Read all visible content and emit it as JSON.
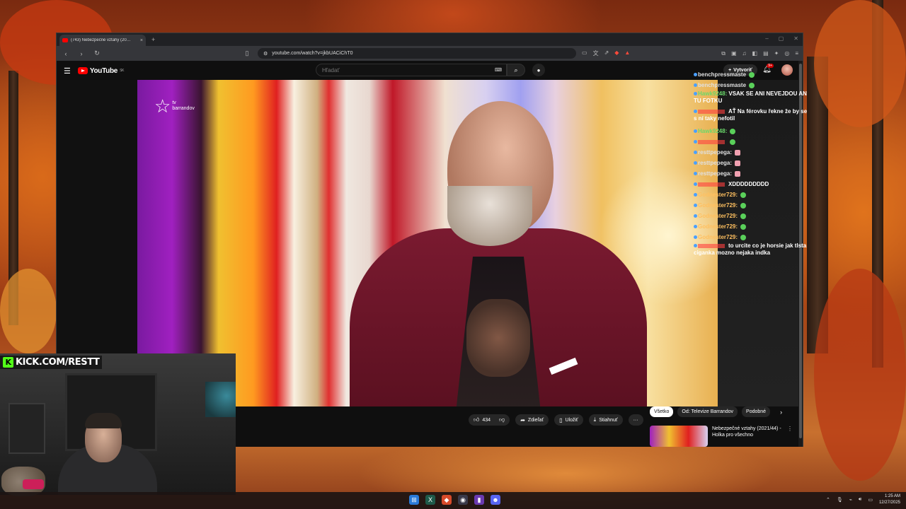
{
  "browser": {
    "tab_title": "(743) Nebezpečné vztahy (20…",
    "tab_close": "×",
    "new_tab": "+",
    "url": "youtube.com/watch?v=jkbUACiChT0",
    "minimize": "–",
    "maximize": "▢",
    "close": "✕"
  },
  "youtube": {
    "logo_text": "YouTube",
    "region": "SK",
    "search_placeholder": "Hľadať",
    "create_label": "Vytvoriť",
    "notifications_count": "9+"
  },
  "video": {
    "channel_watermark": "barrandov",
    "channel_watermark_tv": "tv"
  },
  "chat": [
    {
      "user": "benchpressmaste",
      "message": "",
      "color": "#e0e0e0"
    },
    {
      "user": "benchpressmaste",
      "message": "",
      "color": "#e0e0e0"
    },
    {
      "user": "Hawk9248:",
      "message": "VSAK SE ANI NEVEJDOU AN TU FOTKU",
      "color": "#6ad96a"
    },
    {
      "user": "",
      "message": "AŤ Na férovku řekne že by se s ní taky nefotil",
      "color": "#ff4040"
    },
    {
      "user": "Hawk9248:",
      "message": "",
      "color": "#6ad96a"
    },
    {
      "user": "",
      "message": "",
      "color": "#ff4040"
    },
    {
      "user": "resttpepega:",
      "message": "",
      "color": "#e0e0e0"
    },
    {
      "user": "resttpepega:",
      "message": "",
      "color": "#e0e0e0"
    },
    {
      "user": "resttpepega:",
      "message": "",
      "color": "#e0e0e0"
    },
    {
      "user": "",
      "message": "XDDDDDDDDD",
      "color": "#ff4040"
    },
    {
      "user": "Godnester729:",
      "message": "",
      "color": "#ffc060"
    },
    {
      "user": "Godnester729:",
      "message": "",
      "color": "#ffc060"
    },
    {
      "user": "Godnester729:",
      "message": "",
      "color": "#ffc060"
    },
    {
      "user": "Godnester729:",
      "message": "",
      "color": "#ffc060"
    },
    {
      "user": "Godnester729:",
      "message": "",
      "color": "#ffc060"
    },
    {
      "user": "",
      "message": "to urcite co je horsie jak tlsta ciganka mozno nejaka indka",
      "color": "#ff4040"
    }
  ],
  "actions": {
    "like_count": "434",
    "share_label": "Zdieľať",
    "save_label": "Uložiť",
    "download_label": "Stiahnuť",
    "more_label": "···"
  },
  "chips": [
    "Všetko",
    "Od: Televize Barrandov",
    "Podobné"
  ],
  "recommended": {
    "title": "Nebezpečné vztahy (2021/44) - Holka pro všechno"
  },
  "stream": {
    "kick_label": "KICK.COM/RESTT",
    "kick_k": "K"
  },
  "taskbar": {
    "time": "1:25 AM",
    "date": "12/27/2025"
  }
}
